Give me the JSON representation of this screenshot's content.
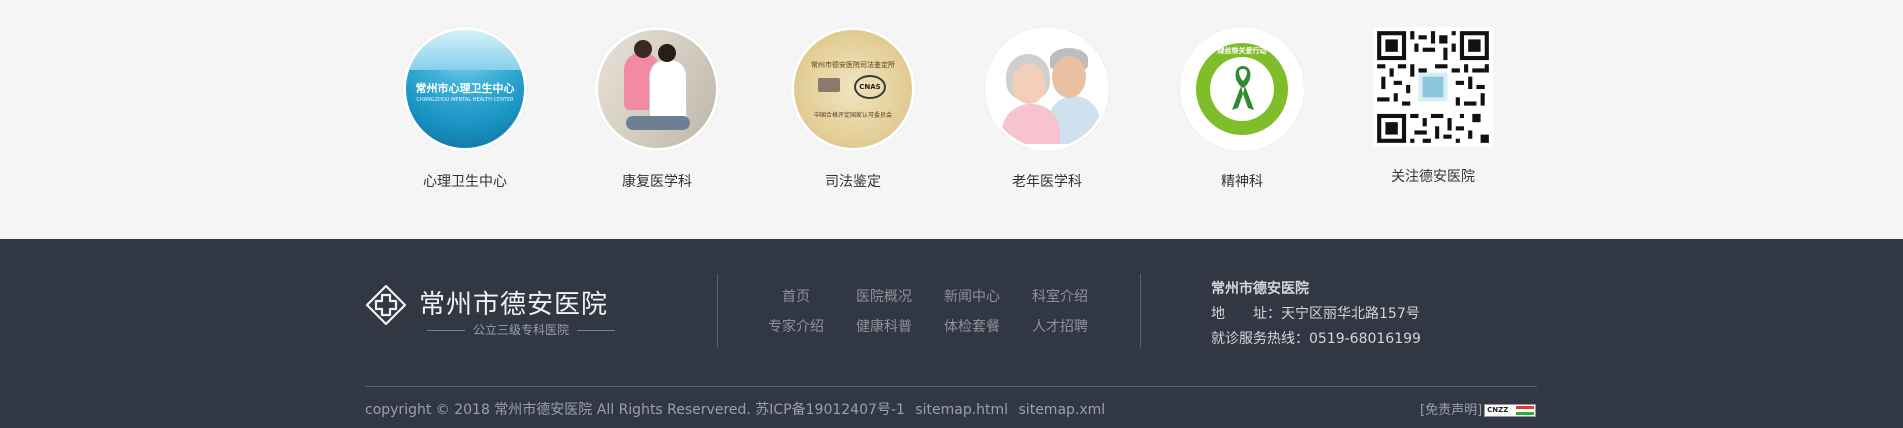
{
  "departments": [
    {
      "label": "心理卫生中心",
      "image_text": "常州市心理卫生中心",
      "image_subtext": "CHANGZHOU MENTAL HEALTH CENTER"
    },
    {
      "label": "康复医学科"
    },
    {
      "label": "司法鉴定",
      "image_text_top": "常州市德安医院司法鉴定所",
      "image_badge": "CNAS",
      "image_text_bottom": "中国合格评定国家认可委员会"
    },
    {
      "label": "老年医学科"
    },
    {
      "label": "精神科",
      "image_text": "绿丝带关爱行动"
    },
    {
      "label": "关注德安医院"
    }
  ],
  "footer": {
    "logo_title": "常州市德安医院",
    "logo_subtitle": "公立三级专科医院",
    "nav": [
      "首页",
      "医院概况",
      "新闻中心",
      "科室介绍",
      "专家介绍",
      "健康科普",
      "体检套餐",
      "人才招聘"
    ],
    "contact": {
      "name": "常州市德安医院",
      "address_label": "地　　址：",
      "address": "天宁区丽华北路157号",
      "phone_label": "就诊服务热线：",
      "phone": "0519-68016199"
    },
    "copyright": "copyright © 2018 常州市德安医院 All Rights Reservered. 苏ICP备19012407号-1",
    "sitemap_html": "sitemap.html",
    "sitemap_xml": "sitemap.xml",
    "disclaimer": "[免责声明]",
    "cnzz_badge": "CNZZ"
  },
  "colors": {
    "footer_bg": "#323744",
    "top_bg": "#f5f5f5",
    "ribbon_green": "#7fbd2b"
  }
}
